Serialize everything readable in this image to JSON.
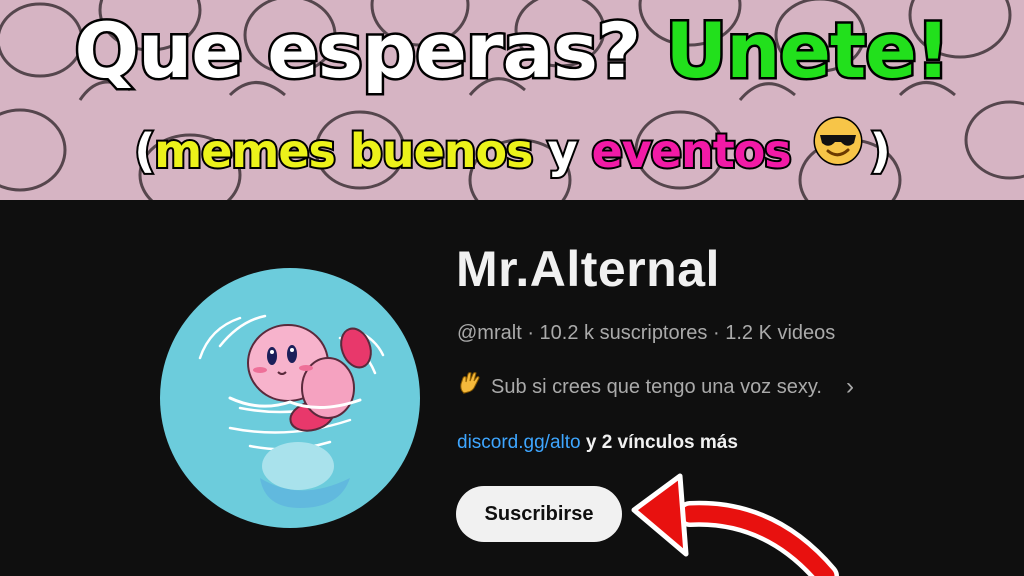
{
  "banner": {
    "headline_part1": "Que esperas?",
    "headline_part2": "Unete!",
    "sub_open": "(",
    "sub_memes": "memes buenos",
    "sub_and": "y",
    "sub_events": "eventos",
    "sub_close": ")",
    "emoji_icon": "sunglasses-smiley-emoji",
    "colors": {
      "green": "#22e01c",
      "yellow": "#ecf21a",
      "pink": "#f21aa6",
      "bg": "#d6b4c3"
    }
  },
  "channel": {
    "name": "Mr.Alternal",
    "handle": "@mralt",
    "subscribers": "10.2 k suscriptores",
    "videos": "1.2 K videos",
    "separator": "·",
    "description_icon": "waving-hand-emoji",
    "description": "Sub si crees que tengo una voz sexy.",
    "link_text": "discord.gg/alto",
    "more_links": "y 2 vínculos más",
    "subscribe_label": "Suscribirse",
    "colors": {
      "background": "#0f0f0f",
      "link": "#3ea6ff",
      "avatar_bg": "#6cccdc",
      "arrow": "#e8110f"
    }
  }
}
